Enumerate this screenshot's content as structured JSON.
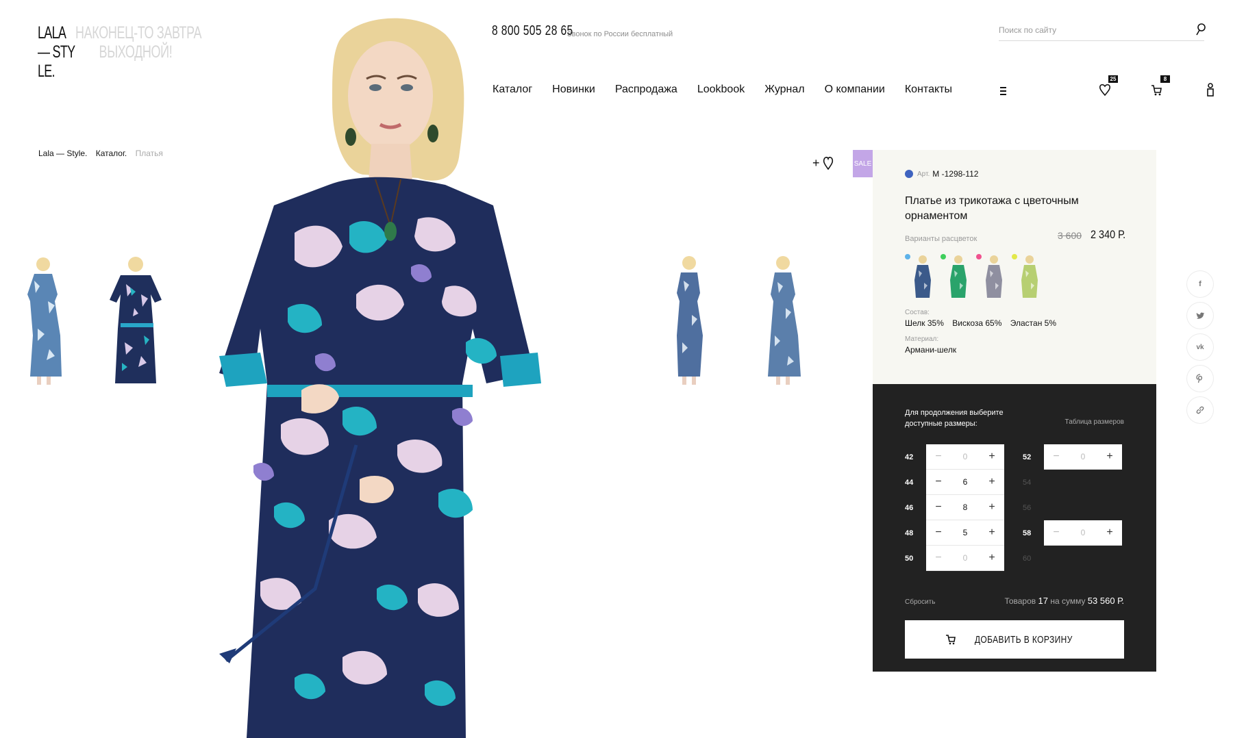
{
  "logo": {
    "line1": "LALA",
    "line2": "— STY",
    "line3": "LE."
  },
  "tagline": {
    "line1": "НАКОНЕЦ-ТО ЗАВТРА",
    "line2": "ВЫХОДНОЙ!"
  },
  "header": {
    "phone": "8 800 505 28 65",
    "phone_note": "Звонок по России бесплатный",
    "search_placeholder": "Поиск по сайту",
    "nav": [
      "Каталог",
      "Новинки",
      "Распродажа",
      "Lookbook",
      "Журнал",
      "О компании",
      "Контакты"
    ],
    "favorites_count": "25",
    "cart_count": "8"
  },
  "breadcrumb": [
    "Lala — Style.",
    "Каталог.",
    "Платья"
  ],
  "product": {
    "sale_label": "SALE",
    "art_label": "Арт.",
    "art_value": "М -1298-112",
    "art_color": "#3f63bf",
    "title": "Платье из трикотажа с цветочным орнаментом",
    "variants_label": "Варианты расцветок",
    "price_old": "3 600",
    "price_new": "2 340 Р.",
    "swatches": [
      {
        "dot": "#5db2e9",
        "dress": "#3b5a8a"
      },
      {
        "dot": "#3fcf5c",
        "dress": "#2aa36b"
      },
      {
        "dot": "#f0528f",
        "dress": "#8f8fa0"
      },
      {
        "dot": "#e2e84a",
        "dress": "#b7cf72"
      }
    ],
    "composition_label": "Состав:",
    "composition": [
      "Шелк 35%",
      "Вискоза 65%",
      "Эластан 5%"
    ],
    "material_label": "Материал:",
    "material": "Армани-шелк"
  },
  "sizes": {
    "note": "Для продолжения выберите доступные размеры:",
    "table_link": "Таблица размеров",
    "left": [
      {
        "size": "42",
        "qty": "0"
      },
      {
        "size": "44",
        "qty": "6"
      },
      {
        "size": "46",
        "qty": "8"
      },
      {
        "size": "48",
        "qty": "5"
      },
      {
        "size": "50",
        "qty": "0"
      }
    ],
    "right": [
      {
        "size": "52",
        "qty": "0",
        "available": true
      },
      {
        "size": "54",
        "available": false
      },
      {
        "size": "56",
        "available": false
      },
      {
        "size": "58",
        "qty": "0",
        "available": true
      },
      {
        "size": "60",
        "available": false
      }
    ],
    "reset": "Сбросить",
    "total_prefix": "Товаров",
    "total_count": "17",
    "total_mid": "на сумму",
    "total_sum": "53 560 Р.",
    "add_to_cart": "ДОБАВИТЬ В КОРЗИНУ"
  },
  "social": [
    "f",
    "twitter-icon",
    "vk",
    "pinterest-icon",
    "link-icon"
  ]
}
